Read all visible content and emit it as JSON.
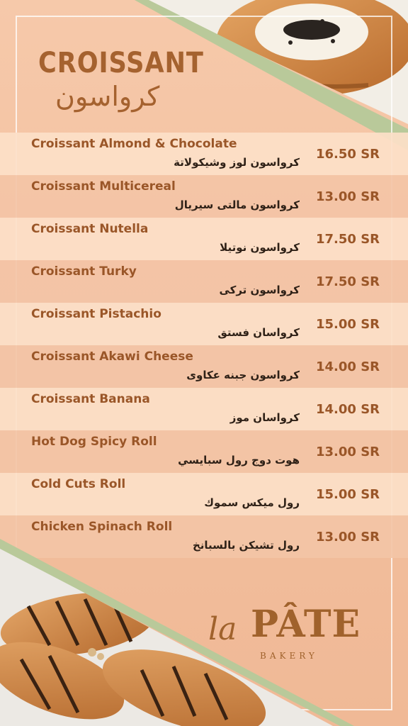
{
  "header": {
    "title_en": "CROISSANT",
    "title_ar": "كرواسون"
  },
  "menu": [
    {
      "name_en": "Croissant Almond & Chocolate",
      "name_ar": "كرواسون لوز وشيكولاتة",
      "price": "16.50 SR"
    },
    {
      "name_en": "Croissant Multicereal",
      "name_ar": "كرواسون مالتى سيريال",
      "price": "13.00 SR"
    },
    {
      "name_en": "Croissant Nutella",
      "name_ar": "كرواسون نوتيلا",
      "price": "17.50 SR"
    },
    {
      "name_en": "Croissant Turky",
      "name_ar": "كرواسون تركى",
      "price": "17.50 SR"
    },
    {
      "name_en": "Croissant Pistachio",
      "name_ar": "كرواسان فستق",
      "price": "15.00 SR"
    },
    {
      "name_en": "Croissant Akawi Cheese",
      "name_ar": "كرواسون جبنه عكاوى",
      "price": "14.00 SR"
    },
    {
      "name_en": "Croissant Banana",
      "name_ar": "كرواسان موز",
      "price": "14.00 SR"
    },
    {
      "name_en": "Hot Dog Spicy Roll",
      "name_ar": "هوت دوج رول سبايسي",
      "price": "13.00 SR"
    },
    {
      "name_en": "Cold Cuts Roll",
      "name_ar": "رول ميكس سموك",
      "price": "15.00 SR"
    },
    {
      "name_en": "Chicken Spinach Roll",
      "name_ar": "رول تشيكن بالسبانخ",
      "price": "13.00 SR"
    }
  ],
  "logo": {
    "la": "la",
    "pate": "PÂTE",
    "bakery": "BAKERY"
  },
  "colors": {
    "accent_brown": "#a5622f",
    "green_band": "#b9c99a",
    "row_light": "#fcdfc8",
    "row_dark": "#f3c4a6"
  },
  "icons": [
    "croissant-photo-top",
    "croissant-photo-bottom"
  ]
}
